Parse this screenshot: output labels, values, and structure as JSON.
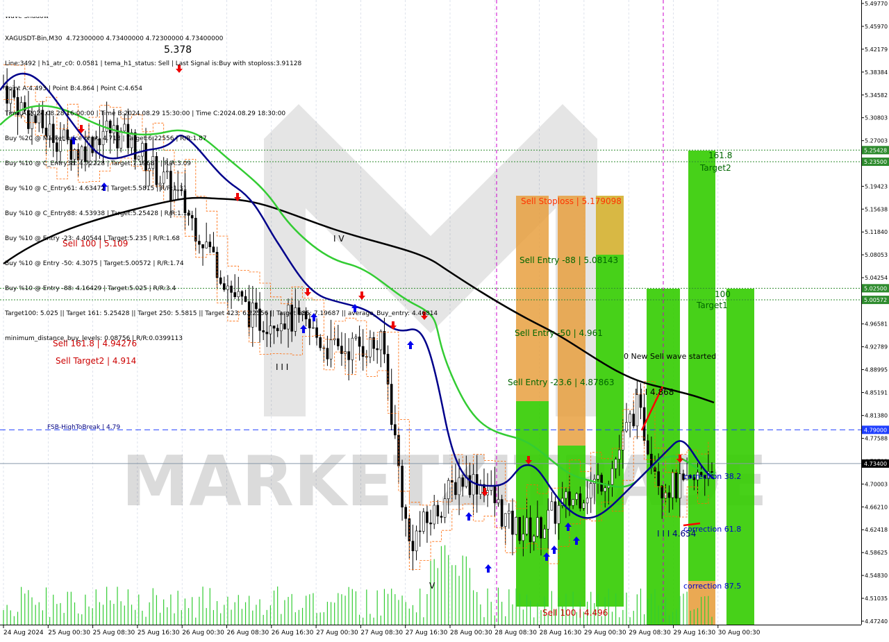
{
  "header": {
    "lines": [
      "XAGUSDT-Bin,M30  4.72300000 4.73400000 4.72300000 4.73400000",
      "Line:3492 | h1_atr_c0: 0.0581 | tema_h1_status: Sell | Last Signal is:Buy with stoploss:3.91128",
      "Point A:4.493 | Point B:4.864 | Point C:4.654",
      "Time A:2024.08.28 16:00:00 | Time B:2024.08.29 15:30:00 | Time C:2024.08.29 18:30:00",
      "Buy %20 @ Market price or at: 4.718 | Target:6.22556 | R/R:1.87",
      "Buy %10 @ C_Entry38: 4.72228 | Target:7.19687 | R/R:3.09",
      "Buy %10 @ C_Entry61: 4.63472 | Target:5.5815 | R/R:1.31",
      "Buy %10 @ C_Entry88: 4.53938 | Target:5.25428 | R/R:1.14",
      "Buy %10 @ Entry -23: 4.40544 | Target:5.235 | R/R:1.68",
      "Buy %10 @ Entry -50: 4.3075 | Target:5.00572 | R/R:1.74",
      "Buy %10 @ Entry -88: 4.16429 | Target:5.025 | R/R:3.4",
      "Target100: 5.025 || Target 161: 5.25428 || Target 250: 5.5815 || Target 423: 6.22556 || Target 685: 7.19687 || average_Buy_entry: 4.46814",
      "minimum_distance_buy_levels: 0.08756 | R/R:0.0399113"
    ],
    "tool_label": "Wave Shadow",
    "big_number": "5.378"
  },
  "watermark": "MARKETZITRADE",
  "axis": {
    "price_ticks": [
      "5.49770",
      "5.45970",
      "5.42179",
      "5.38384",
      "5.34582",
      "5.30803",
      "5.27003",
      "5.23214",
      "5.19423",
      "5.15638",
      "5.11840",
      "5.08053",
      "5.04254",
      "5.00469",
      "4.96581",
      "4.92789",
      "4.88995",
      "4.85191",
      "4.81380",
      "4.77588",
      "4.73793",
      "4.70003",
      "4.66210",
      "4.62418",
      "4.58625",
      "4.54830",
      "4.51035",
      "4.47240"
    ],
    "badges": [
      {
        "label": "5.25428",
        "color": "#2e8b2e"
      },
      {
        "label": "5.23500",
        "color": "#2e8b2e"
      },
      {
        "label": "5.02500",
        "color": "#2e8b2e"
      },
      {
        "label": "5.00572",
        "color": "#2e8b2e"
      },
      {
        "label": "4.79000",
        "color": "#1f3fff"
      },
      {
        "label": "4.73400",
        "color": "#000000"
      }
    ],
    "time_ticks": [
      "24 Aug 2024",
      "25 Aug 00:30",
      "25 Aug 08:30",
      "25 Aug 16:30",
      "26 Aug 00:30",
      "26 Aug 08:30",
      "26 Aug 16:30",
      "27 Aug 00:30",
      "27 Aug 08:30",
      "27 Aug 16:30",
      "28 Aug 00:30",
      "28 Aug 08:30",
      "28 Aug 16:30",
      "29 Aug 00:30",
      "29 Aug 08:30",
      "29 Aug 16:30",
      "30 Aug 00:30"
    ]
  },
  "labels": {
    "sell_100_left": "Sell 100 | 5.109",
    "sell_1618": "Sell 161.8 | 4.94276",
    "sell_target2": "Sell Target2 | 4.914",
    "fsb": "FSB-HighToBreak | 4.79",
    "wave_iv": "I V",
    "wave_iii": "I I I",
    "wave_v": "V",
    "sell_stoploss": "Sell Stoploss | 5.179098",
    "sell_entry_88": "Sell Entry -88 | 5.08143",
    "sell_entry_50": "Sell Entry -50 | 4.961",
    "sell_entry_236": "Sell Entry -23.6 | 4.87863",
    "sell_100_bottom": "Sell 100 | 4.496",
    "target2_level": "161.8",
    "target2": "Target2",
    "target1_level": "100",
    "target1": "Target1",
    "new_sell_wave": "0 New Sell wave started",
    "point_b": "I I I 4.868",
    "point_c": "I I I 4.654",
    "corr_382": "correction 38.2",
    "corr_618": "correction 61.8",
    "corr_875": "correction 87.5"
  },
  "colors": {
    "ma_green": "#33cc33",
    "ma_navy": "#00008b",
    "ma_black": "#000000",
    "orange_dash": "#ff6600",
    "zone_green": "#33cc00",
    "zone_orange": "#e8a040",
    "level_green": "#2e8b2e",
    "fsb_blue": "#1f3fff",
    "sell_red": "#cc0000"
  },
  "chart_data": {
    "type": "candlestick",
    "symbol": "XAGUSDT-Bin",
    "timeframe": "M30",
    "ylim": [
      4.4724,
      5.4977
    ],
    "x": [
      "24 Aug 2024",
      "25 Aug 00:30",
      "25 Aug 08:30",
      "25 Aug 16:30",
      "26 Aug 00:30",
      "26 Aug 08:30",
      "26 Aug 16:30",
      "27 Aug 00:30",
      "27 Aug 08:30",
      "27 Aug 16:30",
      "28 Aug 00:30",
      "28 Aug 08:30",
      "28 Aug 16:30",
      "29 Aug 00:30",
      "29 Aug 08:30",
      "29 Aug 16:30",
      "30 Aug 00:30"
    ],
    "close_path": [
      5.36,
      5.31,
      5.28,
      5.25,
      5.29,
      5.27,
      5.22,
      5.17,
      5.1,
      5.02,
      4.97,
      4.98,
      4.96,
      4.92,
      4.93,
      4.93,
      4.6,
      4.65,
      4.71,
      4.7,
      4.63,
      4.62,
      4.66,
      4.69,
      4.72,
      4.83,
      4.7,
      4.69,
      4.734
    ],
    "horizontal_levels": [
      {
        "value": 5.25428,
        "style": "dotted",
        "color": "#2e8b2e"
      },
      {
        "value": 5.235,
        "style": "dotted",
        "color": "#2e8b2e"
      },
      {
        "value": 5.025,
        "style": "dotted",
        "color": "#2e8b2e"
      },
      {
        "value": 5.00572,
        "style": "dotted",
        "color": "#2e8b2e"
      },
      {
        "value": 4.79,
        "style": "dashed",
        "color": "#1f3fff"
      },
      {
        "value": 4.734,
        "style": "solid",
        "color": "#8899aa"
      }
    ]
  }
}
